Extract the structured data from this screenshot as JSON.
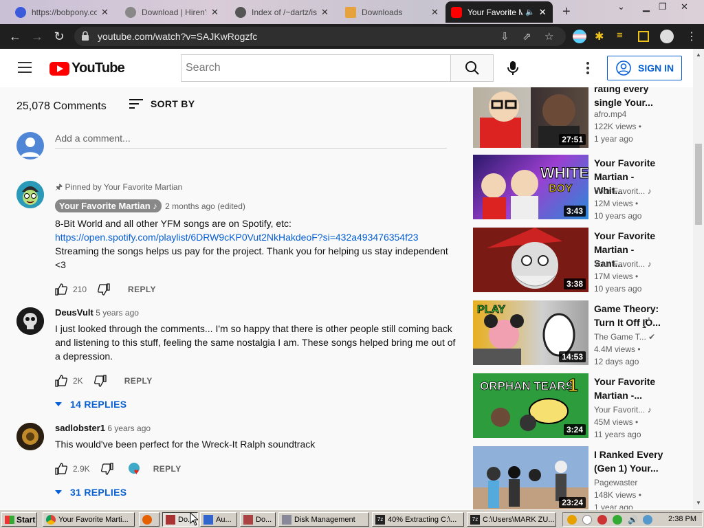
{
  "browser": {
    "tabs": [
      {
        "label": "https://bobpony.co",
        "active": false
      },
      {
        "label": "Download | Hiren's",
        "active": false
      },
      {
        "label": "Index of /~dartz/is",
        "active": false
      },
      {
        "label": "Downloads",
        "active": false
      },
      {
        "label": "Your Favorite M",
        "active": true
      }
    ],
    "url": "youtube.com/watch?v=SAJKwRogzfc"
  },
  "header": {
    "logo": "YouTube",
    "search_placeholder": "Search",
    "signin_label": "SIGN IN"
  },
  "comments_section": {
    "count_label": "25,078 Comments",
    "sort_label": "SORT BY",
    "add_placeholder": "Add a comment...",
    "comments": [
      {
        "pinned_label": "Pinned by Your Favorite Martian",
        "author": "Your Favorite Martian ♪",
        "time": "2 months ago (edited)",
        "text_line1": "8-Bit World and all other YFM songs are on Spotify, etc:",
        "link": "https://open.spotify.com/playlist/6DRW9cKP0Vut2NkHakdeoF?si=432a493476354f23",
        "text_line2": "Streaming the songs helps us pay for the project. Thank you for helping us stay independent <3",
        "likes": "210",
        "reply_label": "REPLY"
      },
      {
        "author": "DeusVult",
        "time": "5 years ago",
        "text": "I just looked through the comments... I'm so happy that there is other people still coming back and listening to this stuff, feeling the same nostalgia I am. These songs helped bring me out of a depression.",
        "likes": "2K",
        "reply_label": "REPLY",
        "replies_label": "14 REPLIES"
      },
      {
        "author": "sadlobster1",
        "time": "6 years ago",
        "text": "This would've been perfect for the Wreck-It Ralph soundtrack",
        "likes": "2.9K",
        "reply_label": "REPLY",
        "replies_label": "31 REPLIES"
      }
    ]
  },
  "sidebar": {
    "videos": [
      {
        "title": "rating every single Your...",
        "channel": "afro.mp4",
        "views": "122K views •",
        "age": "1 year ago",
        "duration": "27:51"
      },
      {
        "title": "Your Favorite Martian - Whit...",
        "channel": "Your Favorit... ♪",
        "views": "12M views •",
        "age": "10 years ago",
        "duration": "3:43"
      },
      {
        "title": "Your Favorite Martian - Sant...",
        "channel": "Your Favorit... ♪",
        "views": "17M views •",
        "age": "10 years ago",
        "duration": "3:38"
      },
      {
        "title": "Game Theory: Turn It Off I̧̨̛Ȯ...",
        "channel": "The Game T... ✔",
        "views": "4.4M views •",
        "age": "12 days ago",
        "duration": "14:53"
      },
      {
        "title": "Your Favorite Martian -...",
        "channel": "Your Favorit... ♪",
        "views": "45M views •",
        "age": "11 years ago",
        "duration": "3:24"
      },
      {
        "title": "I Ranked Every (Gen 1) Your...",
        "channel": "Pagewaster",
        "views": "148K views •",
        "age": "1 year ago",
        "duration": "23:24"
      }
    ]
  },
  "taskbar": {
    "start_label": "Start",
    "buttons": [
      {
        "label": "Your Favorite Marti..."
      },
      {
        "label": ""
      },
      {
        "label": "Do..."
      },
      {
        "label": "Au..."
      },
      {
        "label": "Do..."
      },
      {
        "label": "Disk Management"
      },
      {
        "label": "40% Extracting C:\\..."
      },
      {
        "label": "C:\\Users\\MARK ZU..."
      }
    ],
    "clock": "2:38 PM"
  }
}
